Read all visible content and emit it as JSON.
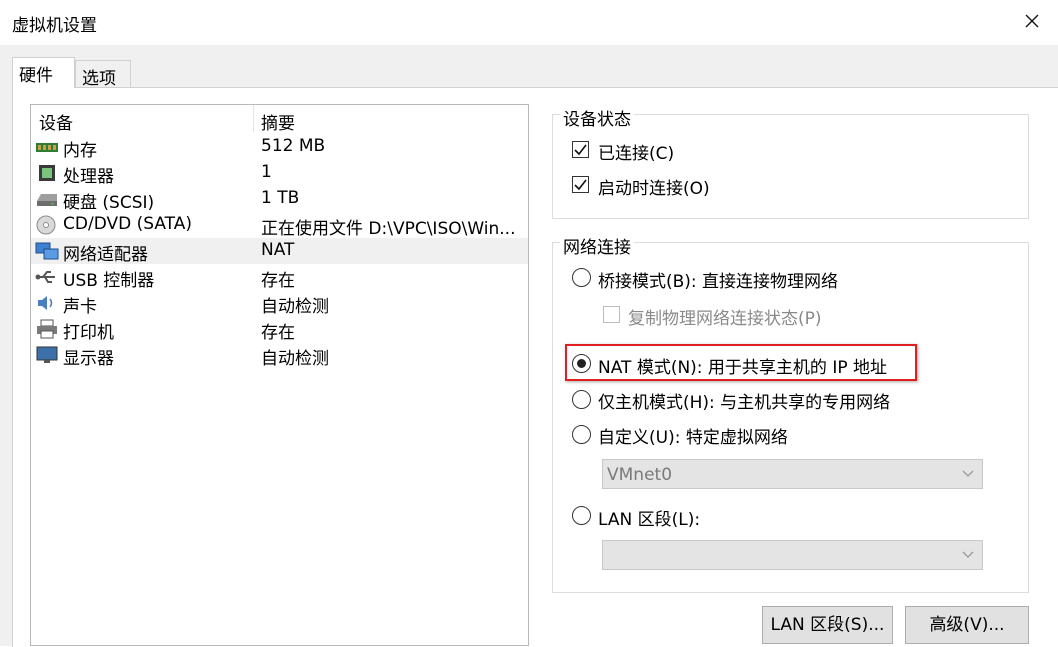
{
  "window": {
    "title": "虚拟机设置"
  },
  "tabs": [
    {
      "label": "硬件",
      "active": true
    },
    {
      "label": "选项",
      "active": false
    }
  ],
  "device_list": {
    "headers": {
      "device": "设备",
      "summary": "摘要"
    },
    "rows": [
      {
        "icon": "memory-icon",
        "name": "内存",
        "summary": "512 MB"
      },
      {
        "icon": "processor-icon",
        "name": "处理器",
        "summary": "1"
      },
      {
        "icon": "hard-disk-icon",
        "name": "硬盘 (SCSI)",
        "summary": "1 TB"
      },
      {
        "icon": "cd-dvd-icon",
        "name": "CD/DVD (SATA)",
        "summary": "正在使用文件 D:\\VPC\\ISO\\Win..."
      },
      {
        "icon": "network-adapter-icon",
        "name": "网络适配器",
        "summary": "NAT",
        "selected": true
      },
      {
        "icon": "usb-icon",
        "name": "USB 控制器",
        "summary": "存在"
      },
      {
        "icon": "sound-card-icon",
        "name": "声卡",
        "summary": "自动检测"
      },
      {
        "icon": "printer-icon",
        "name": "打印机",
        "summary": "存在"
      },
      {
        "icon": "display-icon",
        "name": "显示器",
        "summary": "自动检测"
      }
    ]
  },
  "device_status": {
    "title": "设备状态",
    "connected": {
      "label": "已连接(C)",
      "checked": true
    },
    "connect_at_power_on": {
      "label": "启动时连接(O)",
      "checked": true
    }
  },
  "network_connection": {
    "title": "网络连接",
    "bridged": {
      "label": "桥接模式(B): 直接连接物理网络",
      "selected": false
    },
    "replicate": {
      "label": "复制物理网络连接状态(P)",
      "checked": false,
      "enabled": false
    },
    "nat": {
      "label": "NAT 模式(N): 用于共享主机的 IP 地址",
      "selected": true
    },
    "host_only": {
      "label": "仅主机模式(H): 与主机共享的专用网络",
      "selected": false
    },
    "custom": {
      "label": "自定义(U): 特定虚拟网络",
      "selected": false
    },
    "custom_network_value": "VMnet0",
    "lan_segment": {
      "label": "LAN 区段(L):",
      "selected": false
    },
    "lan_segment_value": ""
  },
  "buttons": {
    "lan_segments": "LAN 区段(S)...",
    "advanced": "高级(V)..."
  },
  "colors": {
    "highlight_box": "#e02020",
    "selected_row": "#f0f0f0"
  }
}
